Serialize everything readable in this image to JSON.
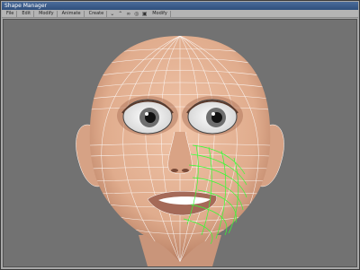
{
  "window": {
    "title": "Shape Manager"
  },
  "menu": {
    "items": [
      "File",
      "Edit",
      "Modify",
      "Animate",
      "Create"
    ],
    "extra_label": "Modify"
  },
  "icons": {
    "toolbar": [
      "chevron-down-icon",
      "chevron-up-icon",
      "link-icon",
      "target-icon",
      "square-icon"
    ]
  },
  "colors": {
    "skin": "#e6b79a",
    "skin_shadow": "#c88f70",
    "wire": "#ffffff",
    "selection": "#33ff33",
    "background": "#727272"
  }
}
